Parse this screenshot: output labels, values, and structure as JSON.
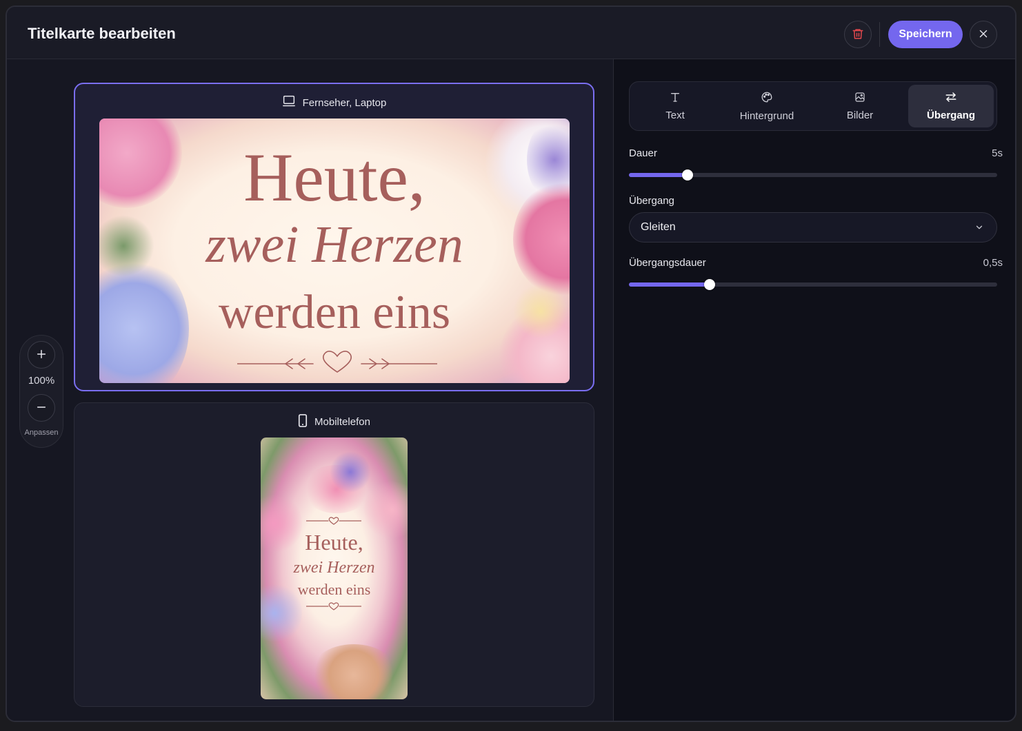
{
  "header": {
    "title": "Titelkarte bearbeiten",
    "save_label": "Speichern"
  },
  "zoom": {
    "level": "100%",
    "fit_label": "Anpassen"
  },
  "previews": {
    "desktop": {
      "label": "Fernseher, Laptop",
      "icon": "monitor-icon",
      "line1": "Heute,",
      "line2": "zwei Herzen",
      "line3": "werden eins"
    },
    "mobile": {
      "label": "Mobiltelefon",
      "icon": "smartphone-icon",
      "line1": "Heute,",
      "line2": "zwei Herzen",
      "line3": "werden eins"
    }
  },
  "tabs": [
    {
      "label": "Text",
      "icon": "text-icon",
      "active": false
    },
    {
      "label": "Hintergrund",
      "icon": "palette-icon",
      "active": false
    },
    {
      "label": "Bilder",
      "icon": "images-icon",
      "active": false
    },
    {
      "label": "Übergang",
      "icon": "transition-icon",
      "active": true
    }
  ],
  "settings": {
    "duration": {
      "label": "Dauer",
      "value": "5s",
      "fraction": 0.16
    },
    "transition": {
      "label": "Übergang",
      "selected": "Gleiten"
    },
    "transition_duration": {
      "label": "Übergangsdauer",
      "value": "0,5s",
      "fraction": 0.22
    }
  },
  "colors": {
    "accent": "#7467ee",
    "delete": "#e5484d"
  }
}
